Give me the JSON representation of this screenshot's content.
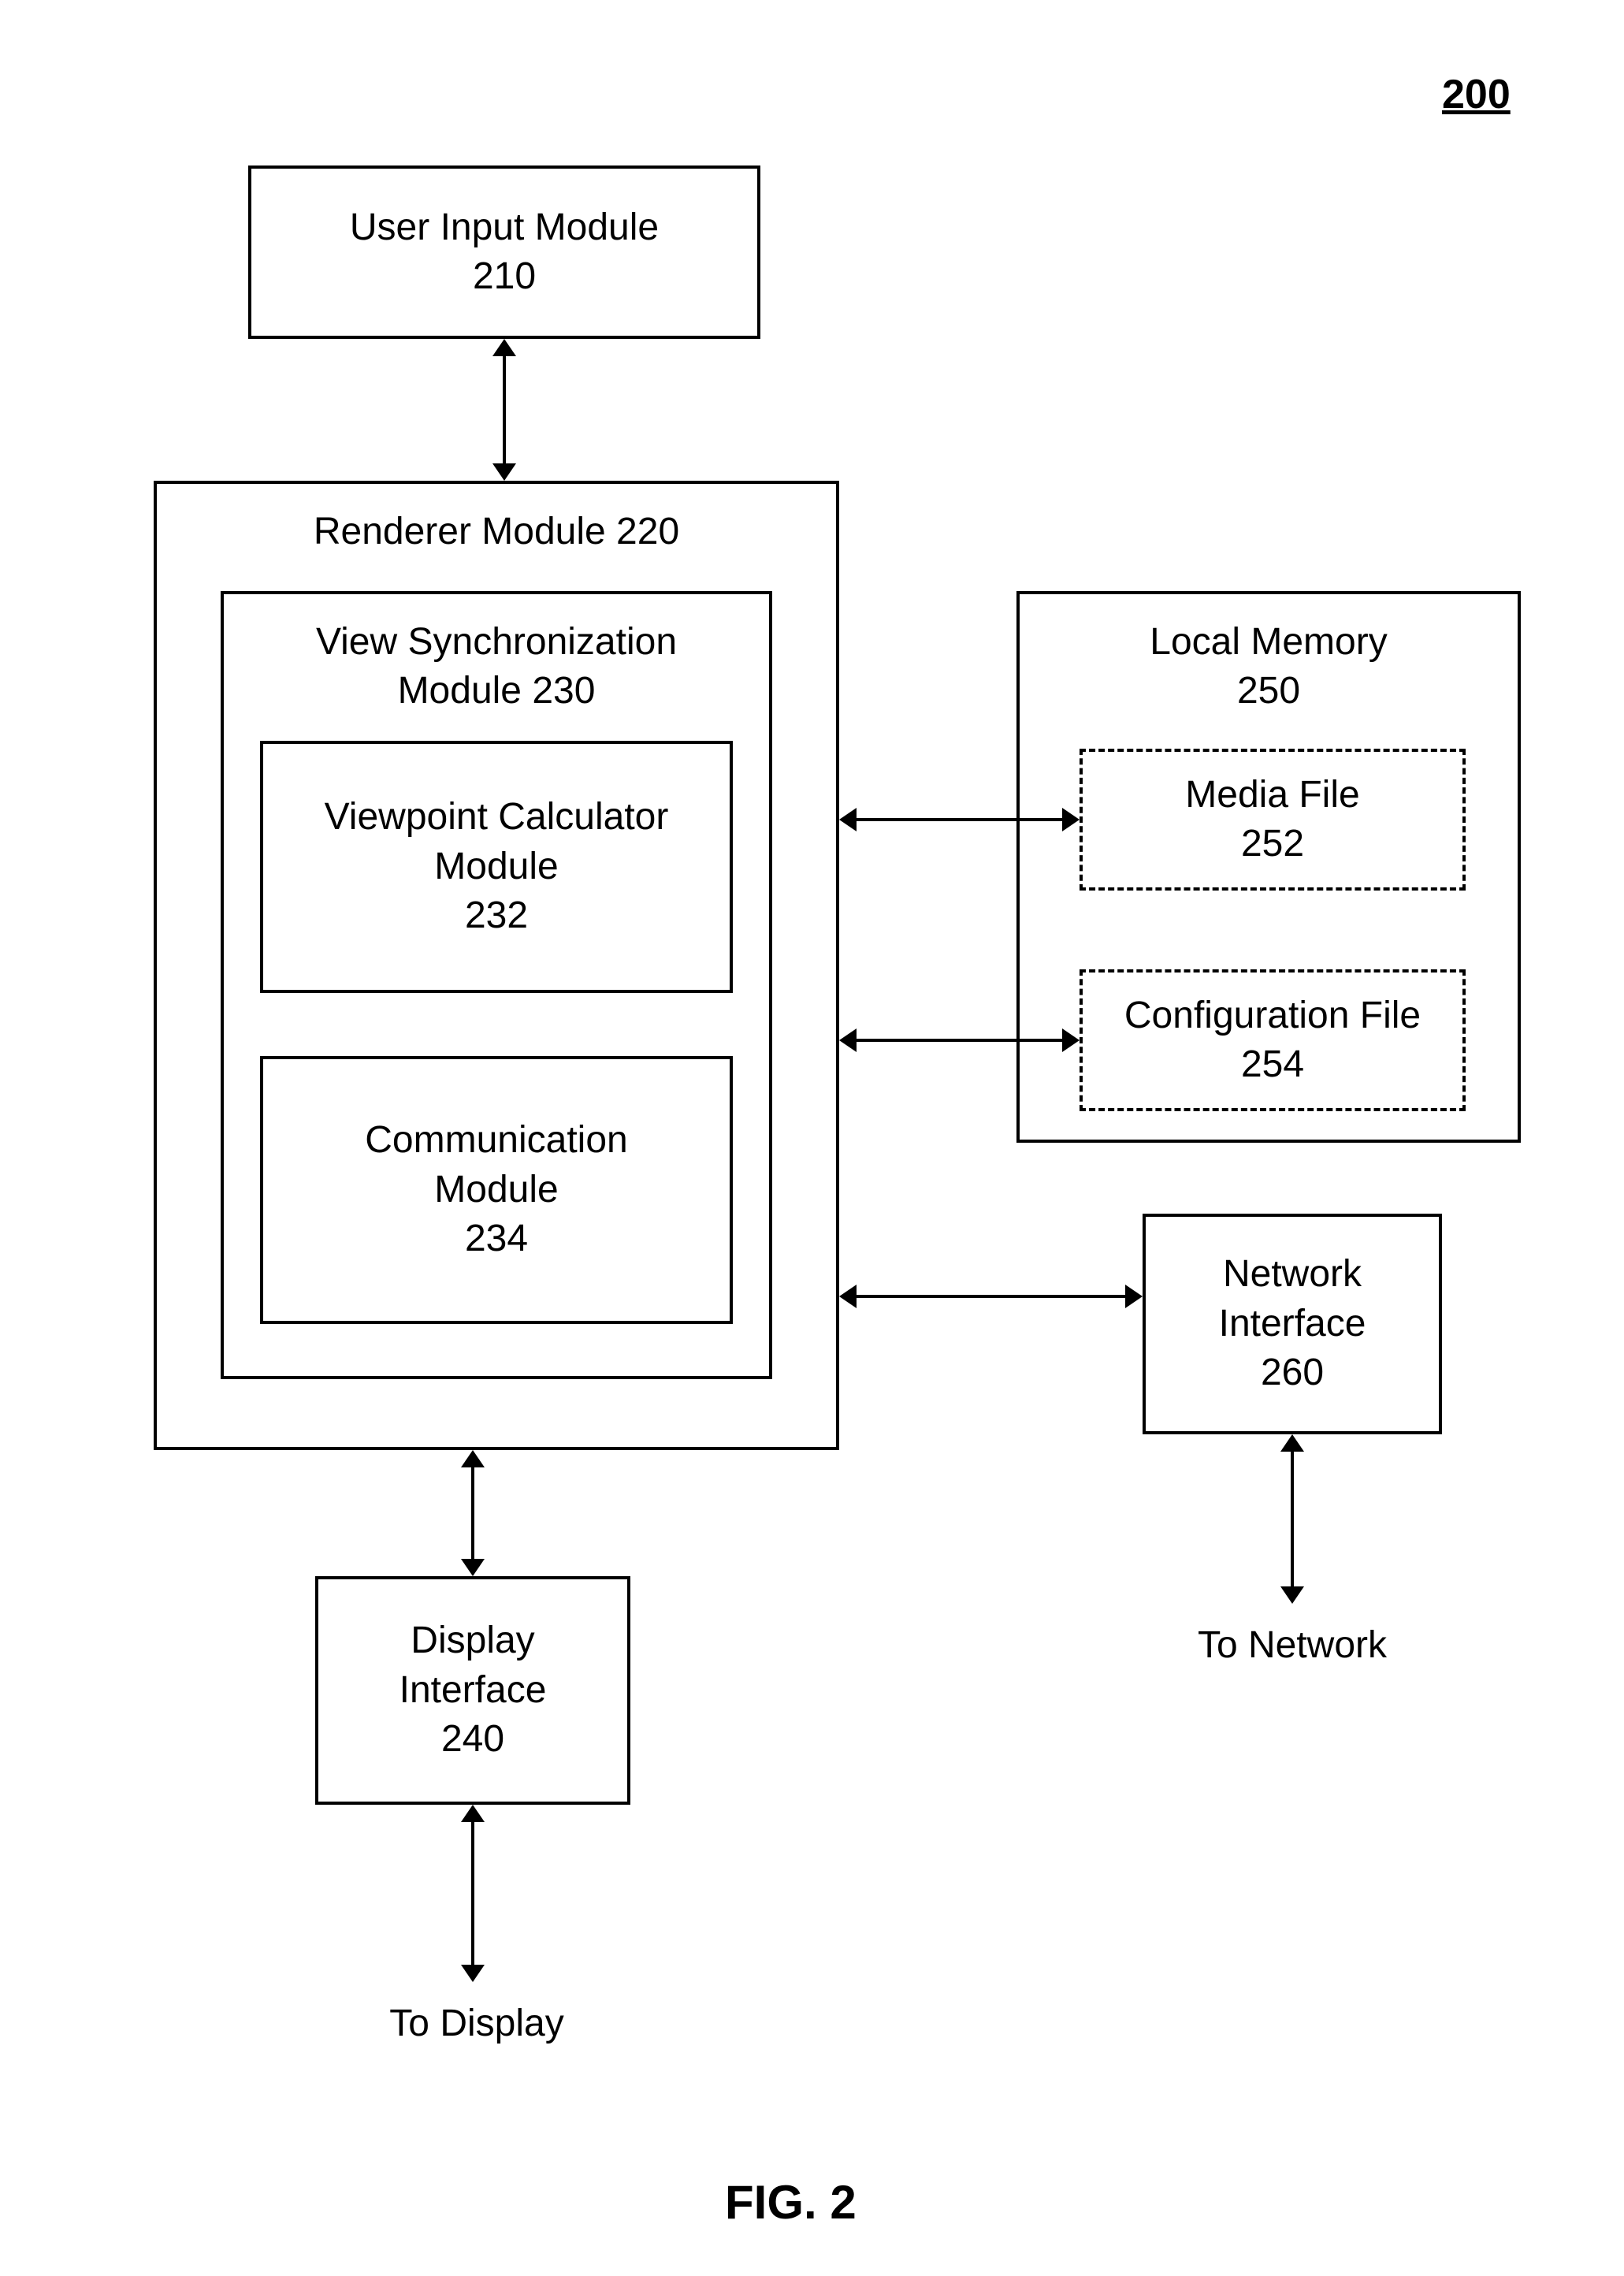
{
  "figure_ref": "200",
  "figure_caption": "FIG. 2",
  "boxes": {
    "user_input": {
      "line1": "User Input Module",
      "line2": "210"
    },
    "renderer": {
      "line1": "Renderer Module 220"
    },
    "view_sync": {
      "line1": "View Synchronization",
      "line2": "Module 230"
    },
    "vp_calc": {
      "line1": "Viewpoint Calculator",
      "line2": "Module",
      "line3": "232"
    },
    "comm": {
      "line1": "Communication",
      "line2": "Module",
      "line3": "234"
    },
    "local_mem": {
      "line1": "Local Memory",
      "line2": "250"
    },
    "media_file": {
      "line1": "Media File",
      "line2": "252"
    },
    "config_file": {
      "line1": "Configuration File",
      "line2": "254"
    },
    "net_if": {
      "line1": "Network",
      "line2": "Interface",
      "line3": "260"
    },
    "disp_if": {
      "line1": "Display",
      "line2": "Interface",
      "line3": "240"
    }
  },
  "labels": {
    "to_network": "To Network",
    "to_display": "To Display"
  }
}
